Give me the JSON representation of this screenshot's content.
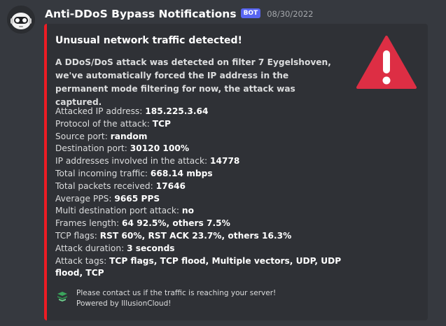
{
  "message": {
    "author": "Anti-DDoS Bypass Notifications",
    "badge": "BOT",
    "timestamp": "08/30/2022",
    "avatar_icon": "robot-avatar-icon"
  },
  "embed": {
    "accent_color": "#ed1c24",
    "title": "Unusual network traffic detected!",
    "description": "A DDoS/DoS attack was detected on filter 7 Eygelshoven, we've automatically forced the IP address in the permanent mode filtering for now, the attack was captured.",
    "thumbnail_icon": "warning-triangle-icon",
    "fields": [
      {
        "label": "Attacked IP address:",
        "value": "185.225.3.64"
      },
      {
        "label": "Protocol of the attack:",
        "value": "TCP"
      },
      {
        "label": "Source port:",
        "value": "random"
      },
      {
        "label": "Destination port:",
        "value": "30120 100%"
      },
      {
        "label": "IP addresses involved in the attack:",
        "value": "14778"
      },
      {
        "label": "Total incoming traffic:",
        "value": "668.14 mbps"
      },
      {
        "label": "Total packets received:",
        "value": "17646"
      },
      {
        "label": "Average PPS:",
        "value": "9665 PPS"
      },
      {
        "label": "Multi destination port attack:",
        "value": "no"
      },
      {
        "label": "Frames length:",
        "value": "64 92.5%, others 7.5%"
      },
      {
        "label": "TCP flags:",
        "value": "RST 60%, RST ACK 23.7%, others 16.3%"
      },
      {
        "label": "Attack duration:",
        "value": "3 seconds"
      },
      {
        "label": "Attack tags:",
        "value": "TCP flags, TCP flood, Multiple vectors, UDP, UDP flood, TCP"
      }
    ],
    "footer": {
      "icon": "illusioncloud-logo-icon",
      "line1": "Please contact us if the traffic is reaching your server!",
      "line2": "Powered by IllusionCloud!"
    }
  }
}
